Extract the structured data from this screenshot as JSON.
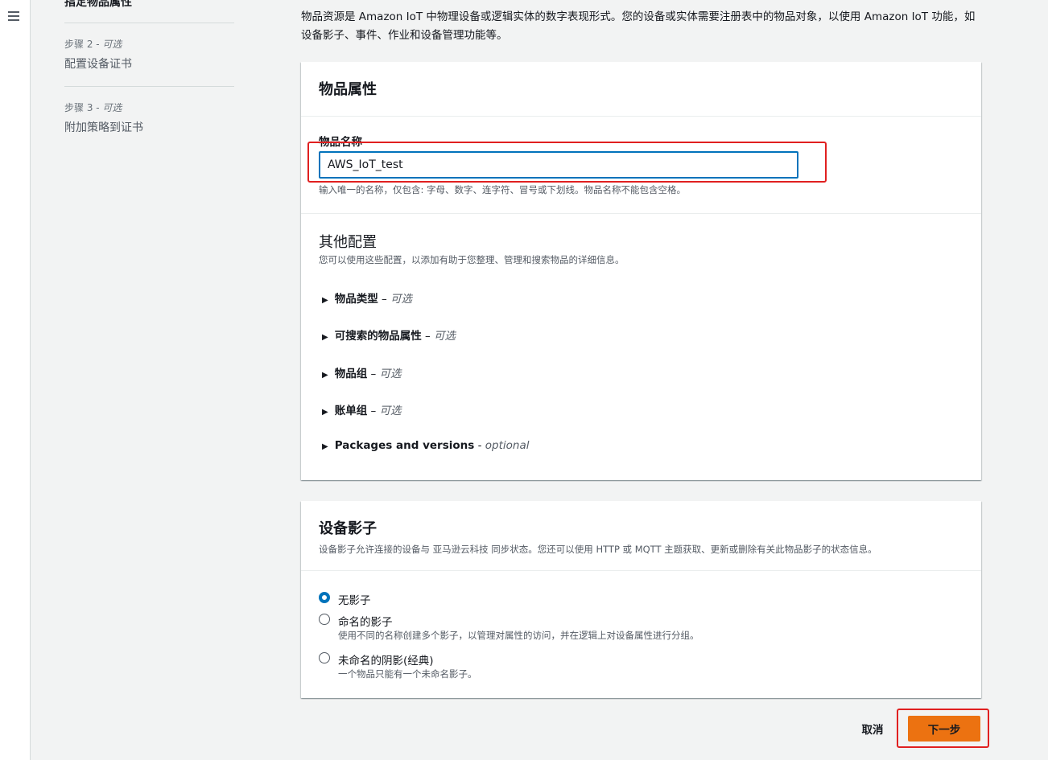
{
  "nav": {
    "current_step": "指定物品属性",
    "steps": [
      {
        "label_prefix": "步骤 2 - ",
        "label_optional": "可选",
        "title": "配置设备证书"
      },
      {
        "label_prefix": "步骤 3 - ",
        "label_optional": "可选",
        "title": "附加策略到证书"
      }
    ]
  },
  "intro": "物品资源是 Amazon IoT 中物理设备或逻辑实体的数字表现形式。您的设备或实体需要注册表中的物品对象，以使用 Amazon IoT 功能，如设备影子、事件、作业和设备管理功能等。",
  "thing_props": {
    "title": "物品属性",
    "name_label": "物品名称",
    "name_value": "AWS_IoT_test",
    "name_hint": "输入唯一的名称，仅包含: 字母、数字、连字符、冒号或下划线。物品名称不能包含空格。",
    "other_title": "其他配置",
    "other_desc": "您可以使用这些配置，以添加有助于您整理、管理和搜索物品的详细信息。",
    "expanders": [
      {
        "label": "物品类型",
        "sep": " – ",
        "optional": "可选"
      },
      {
        "label": "可搜索的物品属性",
        "sep": " – ",
        "optional": "可选"
      },
      {
        "label": "物品组",
        "sep": " – ",
        "optional": "可选"
      },
      {
        "label": "账单组",
        "sep": " – ",
        "optional": "可选"
      },
      {
        "label": "Packages and versions",
        "sep": " - ",
        "optional": "optional"
      }
    ]
  },
  "shadow": {
    "title": "设备影子",
    "desc": "设备影子允许连接的设备与 亚马逊云科技 同步状态。您还可以使用 HTTP 或 MQTT 主题获取、更新或删除有关此物品影子的状态信息。",
    "options": [
      {
        "label": "无影子",
        "sub": "",
        "checked": true
      },
      {
        "label": "命名的影子",
        "sub": "使用不同的名称创建多个影子，以管理对属性的访问，并在逻辑上对设备属性进行分组。",
        "checked": false
      },
      {
        "label": "未命名的阴影(经典)",
        "sub": "一个物品只能有一个未命名影子。",
        "checked": false
      }
    ]
  },
  "footer": {
    "cancel": "取消",
    "next": "下一步"
  },
  "colors": {
    "accent": "#0073bb",
    "primary_button": "#ec7211",
    "highlight_box": "#e02020"
  }
}
